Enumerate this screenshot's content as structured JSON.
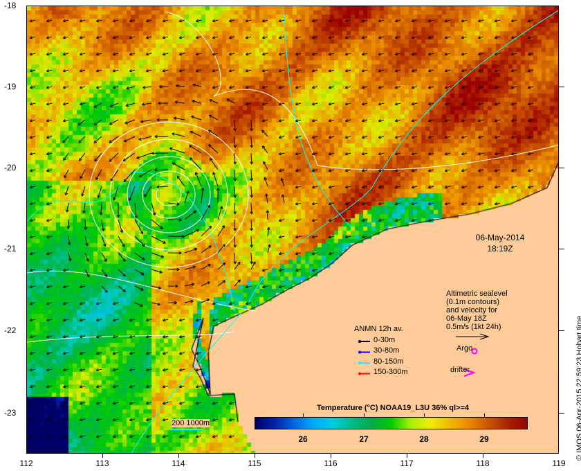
{
  "map": {
    "date": "06-May-2014",
    "time": "18:19Z",
    "x_ticks": [
      "112",
      "113",
      "114",
      "115",
      "116",
      "117",
      "118",
      "119"
    ],
    "y_ticks": [
      "-18",
      "-19",
      "-20",
      "-21",
      "-22",
      "-23"
    ],
    "land_color": "#ffcc99"
  },
  "altimetry_note": {
    "lines": [
      "Altimetric sealevel",
      "(0.1m contours)",
      "and velocity for",
      "06-May 18Z",
      "0.5m/s (1kt 24h)"
    ]
  },
  "anmn_legend": {
    "title": "ANMN 12h av.",
    "items": [
      {
        "label": "0-30m",
        "color": "#000000"
      },
      {
        "label": "30-80m",
        "color": "#0000ff"
      },
      {
        "label": "80-150m",
        "color": "#00ffff"
      },
      {
        "label": "150-300m",
        "color": "#ff0000"
      }
    ]
  },
  "markers": {
    "argo": "Argo",
    "drifter": "drifter",
    "color": "#ff00ff"
  },
  "colorbar": {
    "title": "Temperature (°C) NOAA19_L3U 36% ql>=4",
    "ticks": [
      "26",
      "27",
      "28",
      "29"
    ],
    "range": [
      25.2,
      29.7
    ]
  },
  "scale_bar": {
    "label": "200  1000m",
    "color": "#00ffff"
  },
  "credit": "© IMOS 06-Apr-2015 22:59:23 Hobart time"
}
